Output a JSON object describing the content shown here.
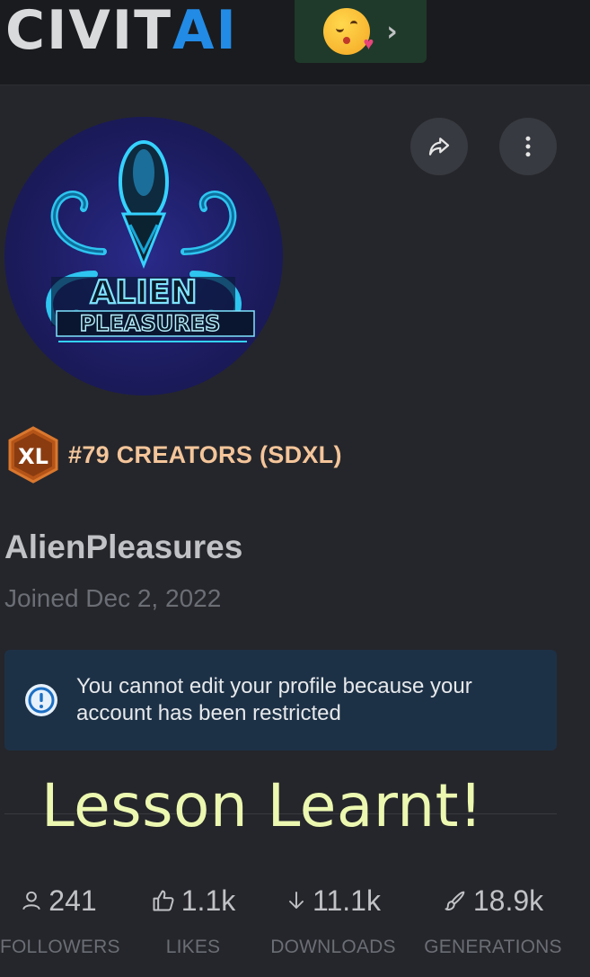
{
  "header": {
    "logo_part1": "CIVIT",
    "logo_part2": "AI",
    "emoji_chevron": "›",
    "logo_icon": "civitai-logo",
    "emoji_icon": "face-blowing-kiss-icon"
  },
  "profile": {
    "avatar_logo_line1": "ALIEN",
    "avatar_logo_line2": "PLEASURES",
    "share_icon": "share-icon",
    "more_icon": "dots-vertical-icon",
    "rank_badge": "XL",
    "rank_text": "#79 CREATORS (SDXL)",
    "username": "AlienPleasures",
    "joined": "Joined Dec 2, 2022"
  },
  "alert": {
    "icon": "info-circle-icon",
    "text": "You cannot edit your profile because your account has been restricted"
  },
  "overlay": {
    "caption": "Lesson Learnt!"
  },
  "stats": [
    {
      "icon": "user-icon",
      "value": "241",
      "label": "FOLLOWERS"
    },
    {
      "icon": "thumb-up-icon",
      "value": "1.1k",
      "label": "LIKES"
    },
    {
      "icon": "arrow-down-icon",
      "value": "11.1k",
      "label": "DOWNLOADS"
    },
    {
      "icon": "brush-icon",
      "value": "18.9k",
      "label": "GENERATIONS"
    }
  ],
  "colors": {
    "background": "#25262b",
    "header_bg": "#1a1b1e",
    "accent_blue": "#228be6",
    "rank_gold": "#f4c59a",
    "alert_bg": "#1d3146",
    "caption_green": "#ecf7b0"
  }
}
